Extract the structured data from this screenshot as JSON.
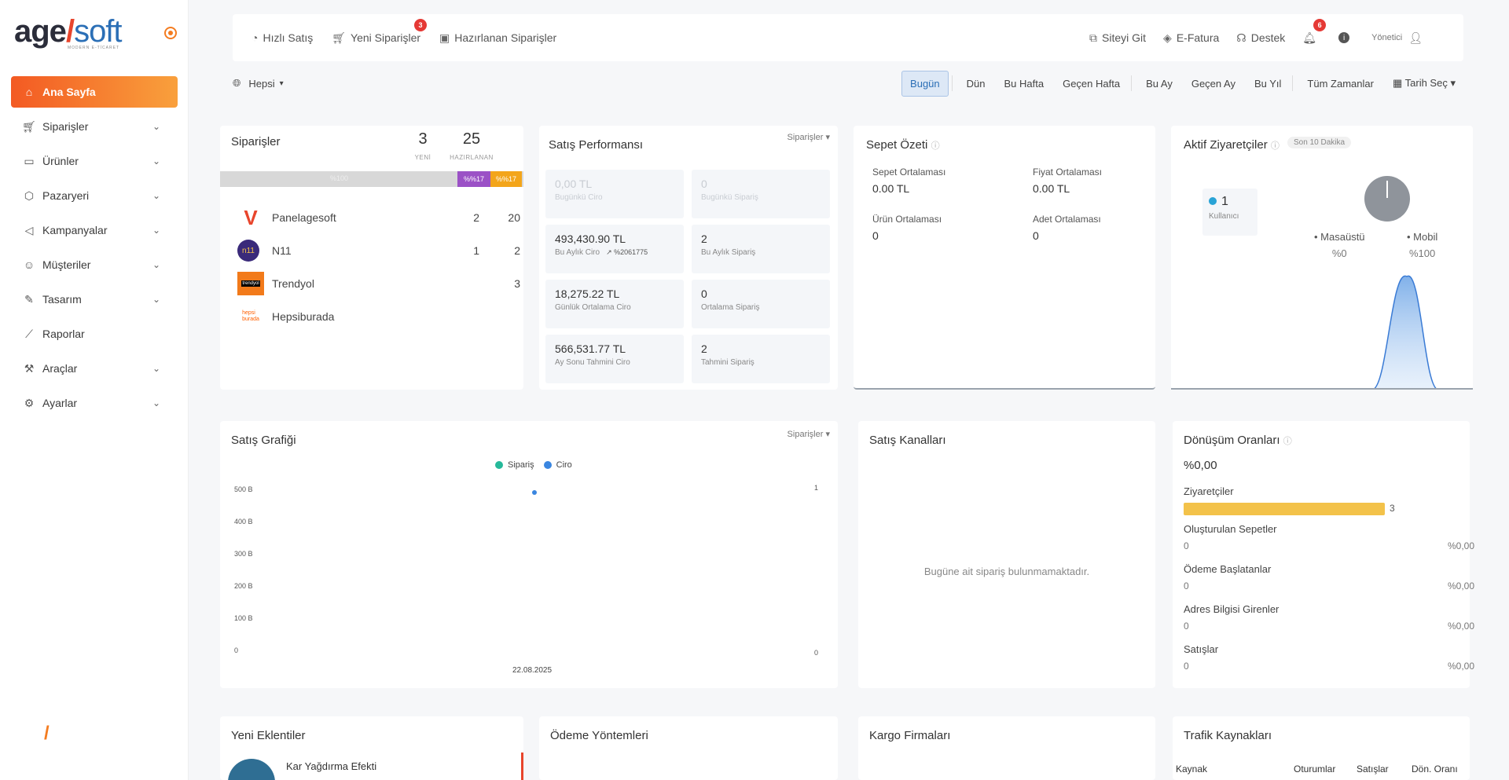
{
  "brand": {
    "name_main": "age",
    "name_slash": "/",
    "name_soft": "soft",
    "tagline": "MODERN E-TİCARET"
  },
  "sidebar": {
    "items": [
      {
        "label": "Ana Sayfa",
        "icon": "home-icon",
        "active": true,
        "has_children": false
      },
      {
        "label": "Siparişler",
        "icon": "cart-icon",
        "active": false,
        "has_children": true
      },
      {
        "label": "Ürünler",
        "icon": "book-icon",
        "active": false,
        "has_children": true
      },
      {
        "label": "Pazaryeri",
        "icon": "box-icon",
        "active": false,
        "has_children": true
      },
      {
        "label": "Kampanyalar",
        "icon": "megaphone-icon",
        "active": false,
        "has_children": true
      },
      {
        "label": "Müşteriler",
        "icon": "users-icon",
        "active": false,
        "has_children": true
      },
      {
        "label": "Tasarım",
        "icon": "pen-icon",
        "active": false,
        "has_children": true
      },
      {
        "label": "Raporlar",
        "icon": "chart-line-icon",
        "active": false,
        "has_children": false
      },
      {
        "label": "Araçlar",
        "icon": "tools-icon",
        "active": false,
        "has_children": true
      },
      {
        "label": "Ayarlar",
        "icon": "gear-icon",
        "active": false,
        "has_children": true
      }
    ]
  },
  "topbar": {
    "quick_sale": "Hızlı Satış",
    "new_orders": "Yeni Siparişler",
    "new_orders_badge": "3",
    "prepared_orders": "Hazırlanan Siparişler",
    "visit_site": "Siteyi Git",
    "e_invoice": "E-Fatura",
    "support": "Destek",
    "notif_badge": "6",
    "user": "Yönetici"
  },
  "filters": {
    "scope": "Hepsi",
    "dates": [
      "Bugün",
      "Dün",
      "Bu Hafta",
      "Geçen Hafta",
      "Bu Ay",
      "Geçen Ay",
      "Bu Yıl",
      "Tüm Zamanlar"
    ],
    "active_date": "Bugün",
    "pick_date": "Tarih Seç"
  },
  "orders": {
    "title": "Siparişler",
    "new_count": "3",
    "new_label": "YENİ",
    "prep_count": "25",
    "prep_label": "HAZIRLANAN",
    "bar_label": "%100",
    "seg1_label": "%%17",
    "seg2_label": "%%17",
    "rows": [
      {
        "name": "Panelagesoft",
        "a": "2",
        "b": "20"
      },
      {
        "name": "N11",
        "a": "1",
        "b": "2"
      },
      {
        "name": "Trendyol",
        "a": "",
        "b": "3"
      },
      {
        "name": "Hepsiburada",
        "a": "",
        "b": ""
      }
    ]
  },
  "performance": {
    "title": "Satış Performansı",
    "filter": "Siparişler",
    "cells": [
      {
        "value": "0,00 TL",
        "label": "Bugünkü Ciro",
        "faded": true,
        "trend": ""
      },
      {
        "value": "0",
        "label": "Bugünkü Sipariş",
        "faded": true,
        "trend": ""
      },
      {
        "value": "493,430.90 TL",
        "label": "Bu Aylık Ciro",
        "faded": false,
        "trend": "↗ %2061775"
      },
      {
        "value": "2",
        "label": "Bu Aylık Sipariş",
        "faded": false,
        "trend": ""
      },
      {
        "value": "18,275.22 TL",
        "label": "Günlük Ortalama Ciro",
        "faded": false,
        "trend": ""
      },
      {
        "value": "0",
        "label": "Ortalama Sipariş",
        "faded": false,
        "trend": ""
      },
      {
        "value": "566,531.77 TL",
        "label": "Ay Sonu Tahmini Ciro",
        "faded": false,
        "trend": ""
      },
      {
        "value": "2",
        "label": "Tahmini Sipariş",
        "faded": false,
        "trend": ""
      }
    ]
  },
  "cart": {
    "title": "Sepet Özeti",
    "items": [
      {
        "label": "Sepet Ortalaması",
        "value": "0.00 TL"
      },
      {
        "label": "Fiyat Ortalaması",
        "value": "0.00 TL"
      },
      {
        "label": "Ürün Ortalaması",
        "value": "0"
      },
      {
        "label": "Adet Ortalaması",
        "value": "0"
      }
    ]
  },
  "visitors": {
    "title": "Aktif Ziyaretçiler",
    "period": "Son 10 Dakika",
    "count": "1",
    "count_label": "Kullanıcı",
    "desktop_label": "Masaüstü",
    "desktop_pct": "%0",
    "mobile_label": "Mobil",
    "mobile_pct": "%100",
    "accent": "#29a3d6"
  },
  "sales_chart": {
    "title": "Satış Grafiği",
    "filter": "Siparişler",
    "legend_order": "Sipariş",
    "legend_revenue": "Ciro",
    "order_color": "#26b99a",
    "revenue_color": "#3a86e0",
    "right_top": "1",
    "right_bottom": "0"
  },
  "chart_data": {
    "type": "scatter",
    "x": [
      "22.08.2025"
    ],
    "series": [
      {
        "name": "Sipariş",
        "values": [
          0
        ]
      },
      {
        "name": "Ciro",
        "values": [
          500
        ]
      }
    ],
    "ylabels": [
      "500 B",
      "400 B",
      "300 B",
      "200 B",
      "100 B",
      "0"
    ],
    "ylim": [
      0,
      500
    ]
  },
  "channels": {
    "title": "Satış Kanalları",
    "empty": "Bugüne ait sipariş bulunmamaktadır."
  },
  "conversion": {
    "title": "Dönüşüm Oranları",
    "rate": "%0,00",
    "visitors_label": "Ziyaretçiler",
    "visitors_value": "3",
    "bar_color": "#f3c24a",
    "rows": [
      {
        "label": "Oluşturulan Sepetler",
        "count": "0",
        "pct": "%0,00"
      },
      {
        "label": "Ödeme Başlatanlar",
        "count": "0",
        "pct": "%0,00"
      },
      {
        "label": "Adres Bilgisi Girenler",
        "count": "0",
        "pct": "%0,00"
      },
      {
        "label": "Satışlar",
        "count": "0",
        "pct": "%0,00"
      }
    ]
  },
  "bottom": {
    "plugins_title": "Yeni Eklentiler",
    "plugin_name": "Kar Yağdırma Efekti",
    "payments_title": "Ödeme Yöntemleri",
    "cargo_title": "Kargo Firmaları",
    "traffic_title": "Trafik Kaynakları",
    "traffic_headers": [
      "Kaynak",
      "Oturumlar",
      "Satışlar",
      "Dön. Oranı"
    ]
  }
}
